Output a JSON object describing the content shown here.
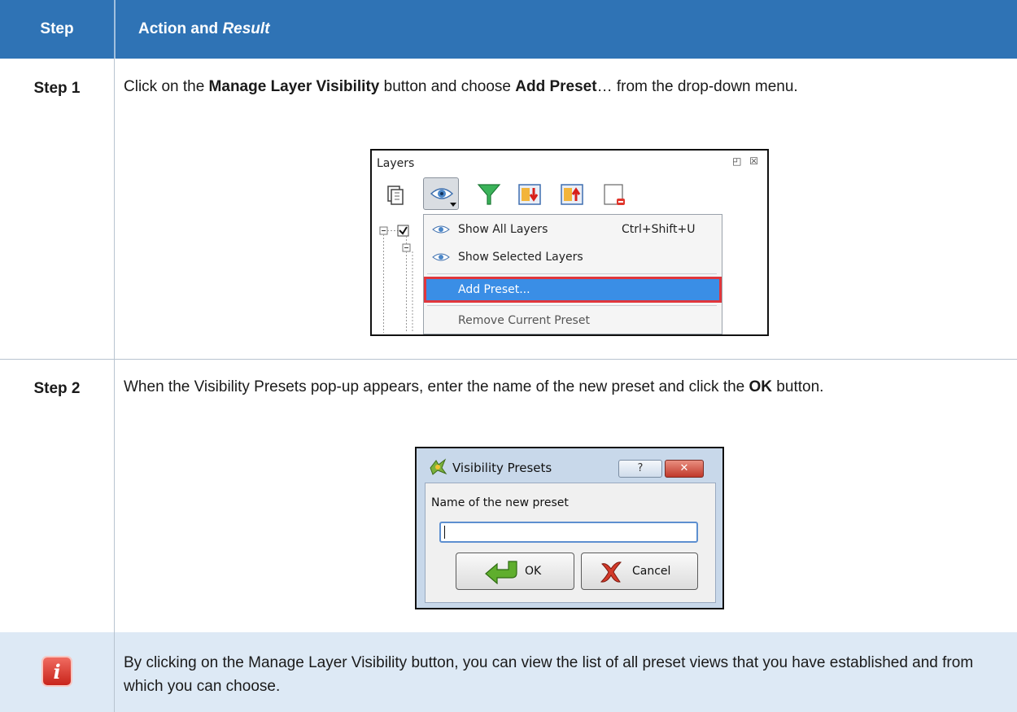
{
  "header": {
    "step_col": "Step",
    "action_col_prefix": "Action and ",
    "action_col_italic": "Result"
  },
  "step1": {
    "label": "Step 1",
    "t1": "Click on the ",
    "b1": "Manage Layer Visibility",
    "t2": " button and choose ",
    "b2": "Add Preset",
    "t3": "… from the drop-down menu.",
    "panel": {
      "title": "Layers",
      "window_controls": "◰ ☒",
      "menu": {
        "show_all": "Show All Layers",
        "show_all_shortcut": "Ctrl+Shift+U",
        "show_selected": "Show Selected Layers",
        "add_preset": "Add Preset...",
        "remove_preset": "Remove Current Preset"
      }
    }
  },
  "step2": {
    "label": "Step 2",
    "t1": "When the Visibility Presets pop-up appears, enter the name of the new preset and click the ",
    "b1": "OK",
    "t2": " button.",
    "dialog": {
      "title": "Visibility Presets",
      "help_btn": "?",
      "close_btn": "✕",
      "field_label": "Name of the new preset",
      "field_value": "",
      "ok": "OK",
      "cancel": "Cancel"
    }
  },
  "note": {
    "icon_glyph": "i",
    "text": "By clicking on the Manage Layer Visibility button, you can view the list of all preset views that you have established and from which you can choose."
  },
  "colors": {
    "header_bg": "#2f73b5",
    "note_bg": "#dde9f5",
    "highlight_border": "#e0363c",
    "menu_highlight": "#3a8ee6"
  }
}
